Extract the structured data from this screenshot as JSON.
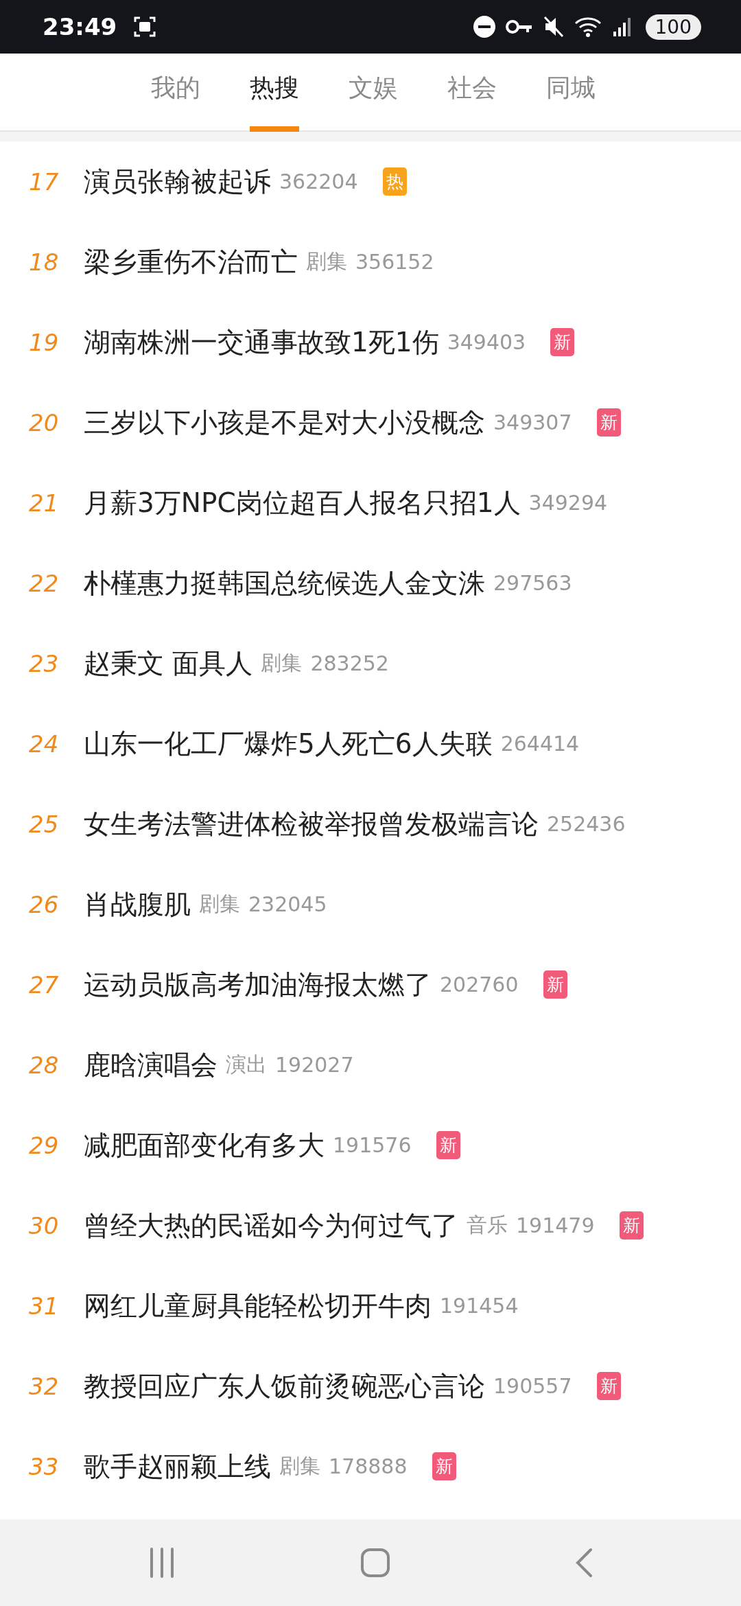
{
  "status_bar": {
    "time": "23:49",
    "battery": "100"
  },
  "tabs": [
    {
      "label": "我的",
      "selected": false
    },
    {
      "label": "热搜",
      "selected": true
    },
    {
      "label": "文娱",
      "selected": false
    },
    {
      "label": "社会",
      "selected": false
    },
    {
      "label": "同城",
      "selected": false
    }
  ],
  "rows": [
    {
      "rank": "17",
      "title": "演员张翰被起诉",
      "count": "362204",
      "badge": {
        "kind": "hot",
        "label": "热"
      }
    },
    {
      "rank": "18",
      "title": "梁乡重伤不治而亡",
      "category": "剧集",
      "count": "356152"
    },
    {
      "rank": "19",
      "title": "湖南株洲一交通事故致1死1伤",
      "count": "349403",
      "badge": {
        "kind": "new",
        "label": "新"
      }
    },
    {
      "rank": "20",
      "title": "三岁以下小孩是不是对大小没概念",
      "count": "349307",
      "badge": {
        "kind": "new",
        "label": "新"
      }
    },
    {
      "rank": "21",
      "title": "月薪3万NPC岗位超百人报名只招1人",
      "count": "349294"
    },
    {
      "rank": "22",
      "title": "朴槿惠力挺韩国总统候选人金文洙",
      "count": "297563"
    },
    {
      "rank": "23",
      "title": "赵秉文 面具人",
      "category": "剧集",
      "count": "283252"
    },
    {
      "rank": "24",
      "title": "山东一化工厂爆炸5人死亡6人失联",
      "count": "264414"
    },
    {
      "rank": "25",
      "title": "女生考法警进体检被举报曾发极端言论",
      "count": "252436"
    },
    {
      "rank": "26",
      "title": "肖战腹肌",
      "category": "剧集",
      "count": "232045"
    },
    {
      "rank": "27",
      "title": "运动员版高考加油海报太燃了",
      "count": "202760",
      "badge": {
        "kind": "new",
        "label": "新"
      }
    },
    {
      "rank": "28",
      "title": "鹿晗演唱会",
      "category": "演出",
      "count": "192027"
    },
    {
      "rank": "29",
      "title": "减肥面部变化有多大",
      "count": "191576",
      "badge": {
        "kind": "new",
        "label": "新"
      }
    },
    {
      "rank": "30",
      "title": "曾经大热的民谣如今为何过气了",
      "category": "音乐",
      "count": "191479",
      "badge": {
        "kind": "new",
        "label": "新"
      }
    },
    {
      "rank": "31",
      "title": "网红儿童厨具能轻松切开牛肉",
      "count": "191454"
    },
    {
      "rank": "32",
      "title": "教授回应广东人饭前烫碗恶心言论",
      "count": "190557",
      "badge": {
        "kind": "new",
        "label": "新"
      }
    },
    {
      "rank": "33",
      "title": "歌手赵丽颖上线",
      "category": "剧集",
      "count": "178888",
      "badge": {
        "kind": "new",
        "label": "新"
      }
    }
  ]
}
